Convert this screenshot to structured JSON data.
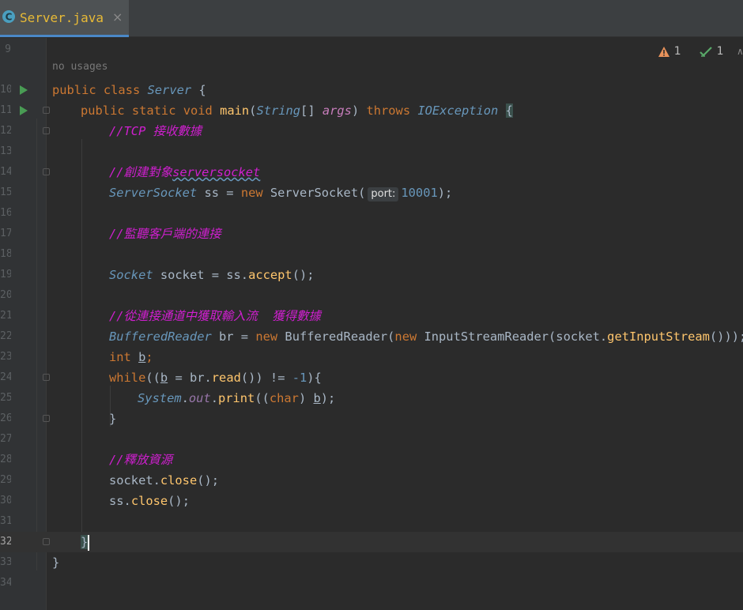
{
  "tab": {
    "filename": "Server.java",
    "close": "×",
    "icon": "java-class-icon"
  },
  "inspections": {
    "warnings": "1",
    "ok": "1",
    "chevron": "∧"
  },
  "usages_hint": "no usages",
  "lines": [
    {
      "num": "9"
    },
    {
      "num": "10"
    },
    {
      "num": "11"
    },
    {
      "num": "12"
    },
    {
      "num": "13"
    },
    {
      "num": "14"
    },
    {
      "num": "15"
    },
    {
      "num": "16"
    },
    {
      "num": "17"
    },
    {
      "num": "18"
    },
    {
      "num": "19"
    },
    {
      "num": "20"
    },
    {
      "num": "21"
    },
    {
      "num": "22"
    },
    {
      "num": "23"
    },
    {
      "num": "24"
    },
    {
      "num": "25"
    },
    {
      "num": "26"
    },
    {
      "num": "27"
    },
    {
      "num": "28"
    },
    {
      "num": "29"
    },
    {
      "num": "30"
    },
    {
      "num": "31"
    },
    {
      "num": "32"
    },
    {
      "num": "33"
    },
    {
      "num": "34"
    }
  ],
  "code": {
    "l10": {
      "public": "public",
      "class": "class",
      "name": "Server",
      "brace": " {"
    },
    "l11": {
      "mods": "public static void",
      "main": "main",
      "open": "(",
      "stringType": "String",
      "arr": "[] ",
      "args": "args",
      "close": ") ",
      "throws": "throws",
      "ex": "IOException",
      "brace": "{"
    },
    "l12": {
      "comment": "//TCP 接收數據"
    },
    "l14": {
      "comment_a": "//創建對象",
      "comment_b": "serversocket"
    },
    "l15": {
      "type": "ServerSocket",
      "var": " ss = ",
      "new": "new",
      "ctor": " ServerSocket(",
      "hint": "port:",
      "num": "10001",
      "end": ");"
    },
    "l17": {
      "comment": "//監聽客戶端的連接"
    },
    "l19": {
      "type": "Socket",
      "rest_a": " socket = ss.",
      "accept": "accept",
      "rest_b": "();"
    },
    "l21": {
      "comment": "//從連接通道中獲取輸入流  獲得數據"
    },
    "l22": {
      "type": "BufferedReader",
      "rest_a": " br = ",
      "new1": "new",
      "ctor": " BufferedReader(",
      "new2": "new",
      "isr": " InputStreamReader(",
      "sock": "socket.",
      "gis": "getInputStream",
      "end": "()));"
    },
    "l23": {
      "int": "int",
      "b": "b",
      "semi": ";"
    },
    "l24": {
      "while": "while",
      "open": "((",
      "b": "b",
      "mid": " = br.",
      "read": "read",
      "rest": "()) != ",
      "num": "-1",
      "end": "){"
    },
    "l25": {
      "sys": "System",
      "dot1": ".",
      "out": "out",
      "dot2": ".",
      "print": "print",
      "open": "((",
      "char": "char",
      "close": ") ",
      "b": "b",
      "end": ");"
    },
    "l26": {
      "brace": "}"
    },
    "l28": {
      "comment": "//釋放資源"
    },
    "l29": {
      "sock": "socket.",
      "close": "close",
      "end": "();"
    },
    "l30": {
      "ss": "ss.",
      "close": "close",
      "end": "();"
    },
    "l32": {
      "brace": "}"
    },
    "l33": {
      "brace": "}"
    }
  },
  "colors": {
    "keyword": "#cc7832",
    "comment": "#cf1fcf",
    "number": "#6897bb",
    "run": "#499c54",
    "tab_title": "#e8ba36"
  }
}
